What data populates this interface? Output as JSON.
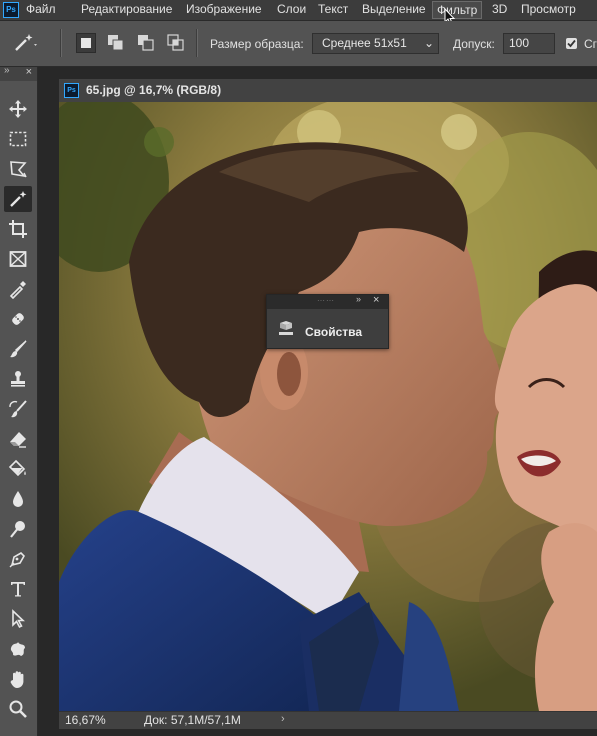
{
  "app": {
    "logo_text": "Ps"
  },
  "menu": {
    "items": [
      "Файл",
      "Редактирование",
      "Изображение",
      "Слои",
      "Текст",
      "Выделение",
      "Фильтр",
      "3D",
      "Просмотр"
    ],
    "active_item": "Фильтр"
  },
  "options": {
    "tool_icon": "magic-wand-icon",
    "selection_modes": [
      "new-selection",
      "add-to-selection",
      "subtract-from-selection",
      "intersect-selection"
    ],
    "sample_size_label": "Размер образца:",
    "sample_size_value": "Среднее 51x51",
    "tolerance_label": "Допуск:",
    "tolerance_value": "100",
    "checkbox_checked": true,
    "checkbox_label_partial": "Сг"
  },
  "tools": [
    {
      "name": "move-icon"
    },
    {
      "name": "marquee-icon"
    },
    {
      "name": "lasso-icon"
    },
    {
      "name": "magic-wand-icon",
      "selected": true
    },
    {
      "name": "crop-icon"
    },
    {
      "name": "frame-icon"
    },
    {
      "name": "eyedropper-icon"
    },
    {
      "name": "healing-brush-icon"
    },
    {
      "name": "brush-icon"
    },
    {
      "name": "clone-stamp-icon"
    },
    {
      "name": "history-brush-icon"
    },
    {
      "name": "eraser-icon"
    },
    {
      "name": "paint-bucket-icon"
    },
    {
      "name": "blur-icon"
    },
    {
      "name": "dodge-icon"
    },
    {
      "name": "pen-icon"
    },
    {
      "name": "type-icon"
    },
    {
      "name": "path-selection-icon"
    },
    {
      "name": "custom-shape-icon"
    },
    {
      "name": "hand-icon"
    },
    {
      "name": "zoom-icon"
    }
  ],
  "document": {
    "icon_text": "Ps",
    "title": "65.jpg @ 16,7% (RGB/8)"
  },
  "status": {
    "zoom": "16,67%",
    "doc_size": "Док: 57,1M/57,1M",
    "arrow": "›"
  },
  "properties_panel": {
    "label": "Свойства"
  },
  "colors": {
    "ui_dark": "#282828",
    "panel": "#535353",
    "menu": "#3c3c3c",
    "ps_blue": "#31a8ff"
  }
}
